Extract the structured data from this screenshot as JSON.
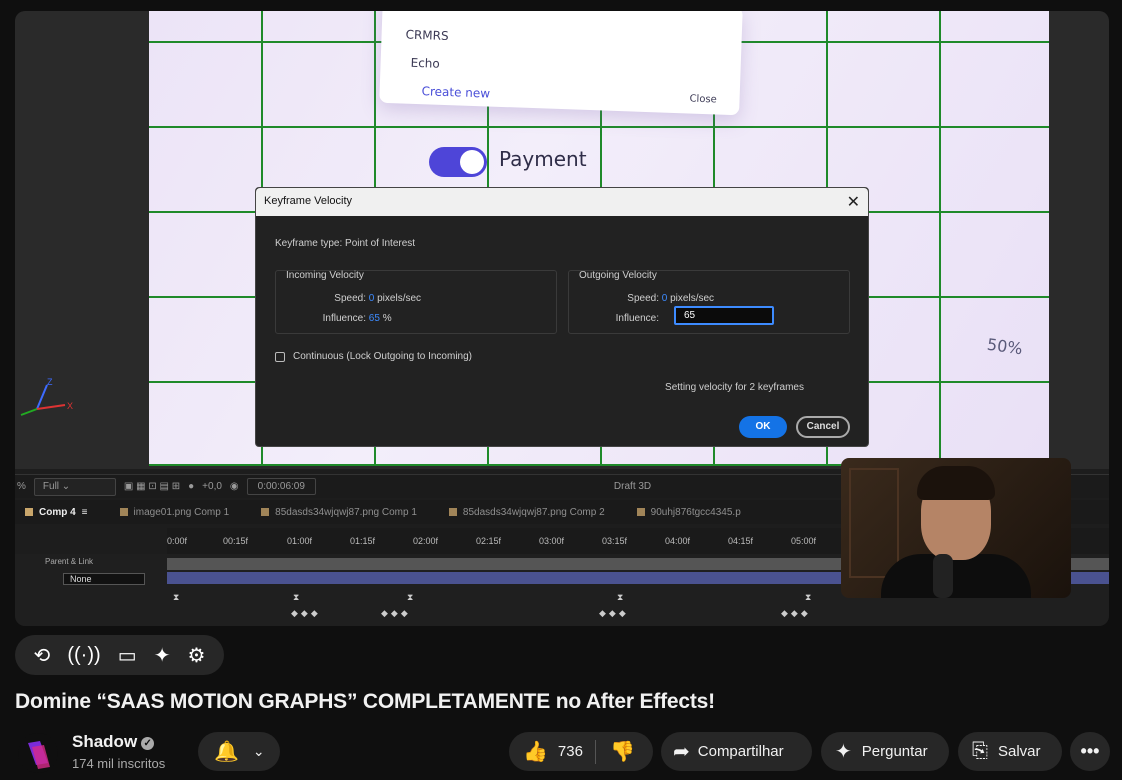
{
  "video": {
    "title": "Domine “SAAS MOTION GRAPHS” COMPLETAMENTE no After Effects!",
    "scene": {
      "menu_items": [
        "CRMRS",
        "Echo",
        "Create new",
        "Close"
      ],
      "toggle_label": "Payment",
      "percent_label": "50%",
      "axis_labels": {
        "z": "Z",
        "x": "X"
      }
    },
    "dialog": {
      "title": "Keyframe Velocity",
      "keyframe_type": "Keyframe type: Point of Interest",
      "incoming": {
        "title": "Incoming Velocity",
        "speed_label": "Speed:",
        "speed_value": "0",
        "speed_unit": "pixels/sec",
        "influence_label": "Influence:",
        "influence_value": "65",
        "influence_unit": "%"
      },
      "outgoing": {
        "title": "Outgoing Velocity",
        "speed_label": "Speed:",
        "speed_value": "0",
        "speed_unit": "pixels/sec",
        "influence_label": "Influence:",
        "influence_value": "65"
      },
      "continuous_label": "Continuous (Lock Outgoing to Incoming)",
      "status": "Setting velocity for 2 keyframes",
      "ok_label": "OK",
      "cancel_label": "Cancel"
    },
    "ae": {
      "zoom": "%",
      "resolution": "Full",
      "exposure": "+0,0",
      "timecode": "0:00:06:09",
      "renderer": "Draft 3D",
      "tabs": [
        "Comp 4",
        "image01.png Comp 1",
        "85dasds34wjqwj87.png Comp 1",
        "85dasds34wjqwj87.png Comp 2",
        "90uhj876tgcc4345.p"
      ],
      "ruler": [
        "0:00f",
        "00:15f",
        "01:00f",
        "01:15f",
        "02:00f",
        "02:15f",
        "03:00f",
        "03:15f",
        "04:00f",
        "04:15f",
        "05:00f"
      ],
      "parent_label": "Parent & Link",
      "parent_value": "None"
    }
  },
  "channel": {
    "name": "Shadow",
    "subscribers": "174 mil inscritos"
  },
  "actions": {
    "likes": "736",
    "share": "Compartilhar",
    "ask": "Perguntar",
    "save": "Salvar"
  },
  "colors": {
    "accent": "#1473e6",
    "grid": "#1f8a2a",
    "background": "#0f0f0f"
  }
}
